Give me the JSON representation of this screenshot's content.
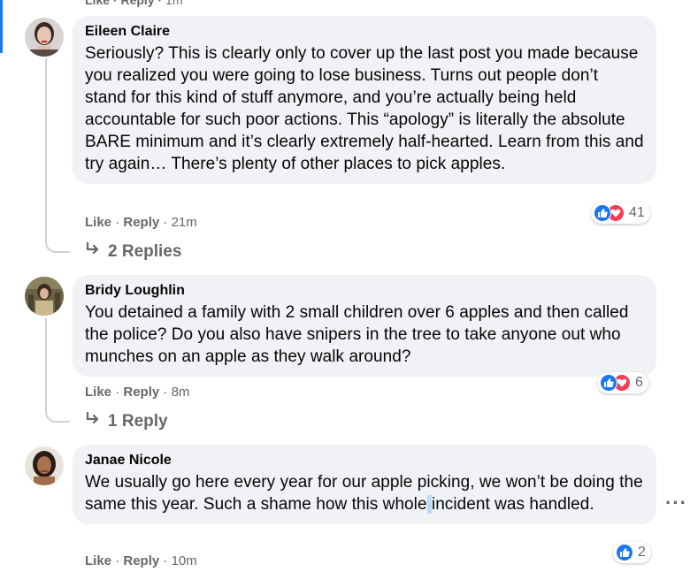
{
  "top_actions": {
    "like": "Like",
    "sep": "·",
    "reply": "Reply",
    "time": "1m"
  },
  "comments": [
    {
      "author": "Eileen Claire",
      "text": "Seriously? This is clearly only to cover up the last post you made because you realized you were going to lose business. Turns out people don’t stand for this kind of stuff anymore, and you’re actually being held accountable for such poor actions. This “apology” is literally the absolute BARE minimum and it’s clearly extremely half-hearted. Learn from this and try again… There’s plenty of other places to pick apples.",
      "like_label": "Like",
      "sep": "·",
      "reply_label": "Reply",
      "time": "21m",
      "reaction_count": "41",
      "replies_label": "2 Replies"
    },
    {
      "author": "Bridy Loughlin",
      "text": "You detained a family with 2 small children over 6 apples and then called the police? Do you also have snipers in the tree to take anyone out who munches on an apple as they walk around?",
      "like_label": "Like",
      "sep": "·",
      "reply_label": "Reply",
      "time": "8m",
      "reaction_count": "6",
      "replies_label": "1 Reply"
    },
    {
      "author": "Janae Nicole",
      "text_before": "We usually go here every year for our apple picking, we won’t be doing the same this year. Such a shame how this whole",
      "text_caret": " ",
      "text_after": "incident was handled.",
      "like_label": "Like",
      "sep": "·",
      "reply_label": "Reply",
      "time": "10m",
      "reaction_count": "2"
    }
  ],
  "more_options": "···",
  "colors": {
    "accent": "#1877f2",
    "love": "#f33e58",
    "bubble": "#f0f2f5",
    "meta": "#65676b"
  }
}
